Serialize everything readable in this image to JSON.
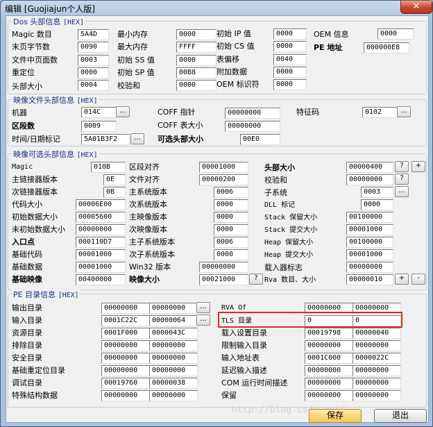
{
  "window": {
    "title": "编辑 [Guojiajun个人版]",
    "close_glyph": "✕"
  },
  "hex_tag": "[HEX]",
  "dos_header": {
    "title": "Dos 头部信息",
    "fields": [
      {
        "label": "Magic 数目",
        "value": "5A4D"
      },
      {
        "label": "末页字节数",
        "value": "0090"
      },
      {
        "label": "文件中页面数",
        "value": "0003"
      },
      {
        "label": "重定位",
        "value": "0000"
      },
      {
        "label": "头部大小",
        "value": "0004"
      },
      {
        "label": "最小内存",
        "value": "0000"
      },
      {
        "label": "最大内存",
        "value": "FFFF"
      },
      {
        "label": "初始 SS 值",
        "value": "0000"
      },
      {
        "label": "初始 SP 值",
        "value": "00B8"
      },
      {
        "label": "校验和",
        "value": "0000"
      },
      {
        "label": "初始 IP 值",
        "value": "0000"
      },
      {
        "label": "初始 CS 值",
        "value": "0000"
      },
      {
        "label": "表偏移",
        "value": "0040"
      },
      {
        "label": "附加数据",
        "value": "0000"
      },
      {
        "label": "OEM 标识符",
        "value": "0000"
      },
      {
        "label": "OEM 信息",
        "value": "0000"
      },
      {
        "label": "PE 地址",
        "value": "000000E8"
      }
    ]
  },
  "file_header": {
    "title": "映像文件头部信息",
    "fields": [
      {
        "label": "机器",
        "value": "014C"
      },
      {
        "label": "区段数",
        "value": "0009"
      },
      {
        "label": "时间/日期标记",
        "value": "5A01B3F2"
      },
      {
        "label": "COFF 指针",
        "value": "00000000"
      },
      {
        "label": "COFF 表大小",
        "value": "00000000"
      },
      {
        "label": "可选头部大小",
        "value": "00E0"
      },
      {
        "label": "特征码",
        "value": "0102"
      }
    ]
  },
  "optional_header": {
    "title": "映像可选头部信息",
    "fields": [
      {
        "label": "Magic",
        "value": "010B"
      },
      {
        "label": "主链接器版本",
        "value": "0E"
      },
      {
        "label": "次链接器版本",
        "value": "0B"
      },
      {
        "label": "代码大小",
        "value": "00006E00"
      },
      {
        "label": "初始数据大小",
        "value": "00005600"
      },
      {
        "label": "未初始数据大小",
        "value": "00000000"
      },
      {
        "label": "入口点",
        "value": "000110D7"
      },
      {
        "label": "基础代码",
        "value": "00001000"
      },
      {
        "label": "基础数据",
        "value": "00001000"
      },
      {
        "label": "基础映像",
        "value": "00400000"
      },
      {
        "label": "区段对齐",
        "value": "00001000"
      },
      {
        "label": "文件对齐",
        "value": "00000200"
      },
      {
        "label": "主系统版本",
        "value": "0006"
      },
      {
        "label": "次系统版本",
        "value": "0000"
      },
      {
        "label": "主映像版本",
        "value": "0000"
      },
      {
        "label": "次映像版本",
        "value": "0000"
      },
      {
        "label": "主子系统版本",
        "value": "0006"
      },
      {
        "label": "次子系统版本",
        "value": "0000"
      },
      {
        "label": "Win32 版本",
        "value": "00000000"
      },
      {
        "label": "映像大小",
        "value": "00021000"
      },
      {
        "label": "头部大小",
        "value": "00000400"
      },
      {
        "label": "校验和",
        "value": "00000000"
      },
      {
        "label": "子系统",
        "value": "0003"
      },
      {
        "label": "DLL 标记",
        "value": "0000"
      },
      {
        "label": "Stack 保留大小",
        "value": "00100000"
      },
      {
        "label": "Stack 提交大小",
        "value": "00001000"
      },
      {
        "label": "Heap 保留大小",
        "value": "00100000"
      },
      {
        "label": "Heap 提交大小",
        "value": "00001000"
      },
      {
        "label": "载入器标志",
        "value": "00000000"
      },
      {
        "label": "Rva 数目、大小",
        "value": "00000010"
      }
    ]
  },
  "data_dirs": {
    "title": "PE 目录信息",
    "left": [
      {
        "label": "输出目录",
        "rva": "00000000",
        "size": "00000000"
      },
      {
        "label": "输入目录",
        "rva": "0001C22C",
        "size": "00000064"
      },
      {
        "label": "资源目录",
        "rva": "0001F000",
        "size": "0000043C"
      },
      {
        "label": "排除目录",
        "rva": "00000000",
        "size": "00000000"
      },
      {
        "label": "安全目录",
        "rva": "00000000",
        "size": "00000000"
      },
      {
        "label": "基础重定位目录",
        "rva": "00000000",
        "size": "00000000"
      },
      {
        "label": "调试目录",
        "rva": "00019760",
        "size": "00000038"
      },
      {
        "label": "特殊结构数据",
        "rva": "00000000",
        "size": "00000000"
      }
    ],
    "right": [
      {
        "label": "RVA Of",
        "rva": "00000000",
        "size": "00000000"
      },
      {
        "label": "TLS 目录",
        "rva": "0",
        "size": "0"
      },
      {
        "label": "载入设置目录",
        "rva": "00019798",
        "size": "00000040"
      },
      {
        "label": "限制输入目录",
        "rva": "00000000",
        "size": "00000000"
      },
      {
        "label": "输入地址表",
        "rva": "0001C000",
        "size": "0000022C"
      },
      {
        "label": "延迟输入描述",
        "rva": "00000000",
        "size": "00000000"
      },
      {
        "label": "COM 运行时间描述",
        "rva": "00000000",
        "size": "00000000"
      },
      {
        "label": "保留",
        "rva": "00000000",
        "size": "00000000"
      }
    ]
  },
  "buttons": {
    "browse": "...",
    "help": "?",
    "plus": "+",
    "minus": "-",
    "save": "保存",
    "exit": "退出"
  },
  "watermark": "http://blog.csdn.net/"
}
